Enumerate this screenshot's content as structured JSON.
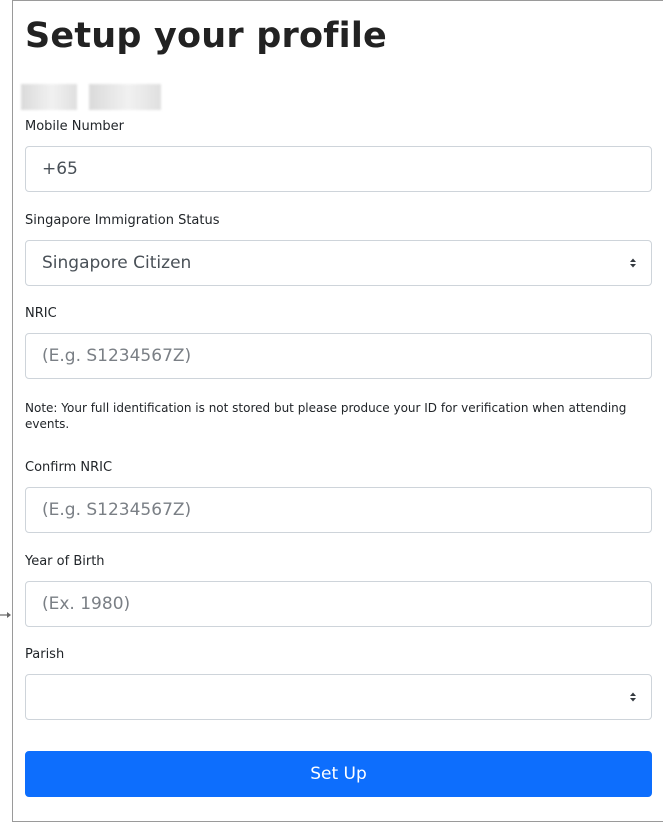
{
  "page": {
    "title": "Setup your profile"
  },
  "form": {
    "mobile": {
      "label": "Mobile Number",
      "value": "+65"
    },
    "immigration_status": {
      "label": "Singapore Immigration Status",
      "value": "Singapore Citizen"
    },
    "nric": {
      "label": "NRIC",
      "placeholder": "(E.g. S1234567Z)"
    },
    "note": "Note: Your full identification is not stored but please produce your ID for verification when attending events.",
    "confirm_nric": {
      "label": "Confirm NRIC",
      "placeholder": "(E.g. S1234567Z)"
    },
    "year_of_birth": {
      "label": "Year of Birth",
      "placeholder": "(Ex. 1980)"
    },
    "parish": {
      "label": "Parish",
      "value": ""
    },
    "submit_label": "Set Up"
  },
  "icons": {
    "select_caret": "caret-up-down-icon",
    "external_arrow": "arrow-right-icon"
  },
  "colors": {
    "primary": "#0d6efd",
    "border": "#ced4da",
    "frame": "#9a9a9a"
  }
}
